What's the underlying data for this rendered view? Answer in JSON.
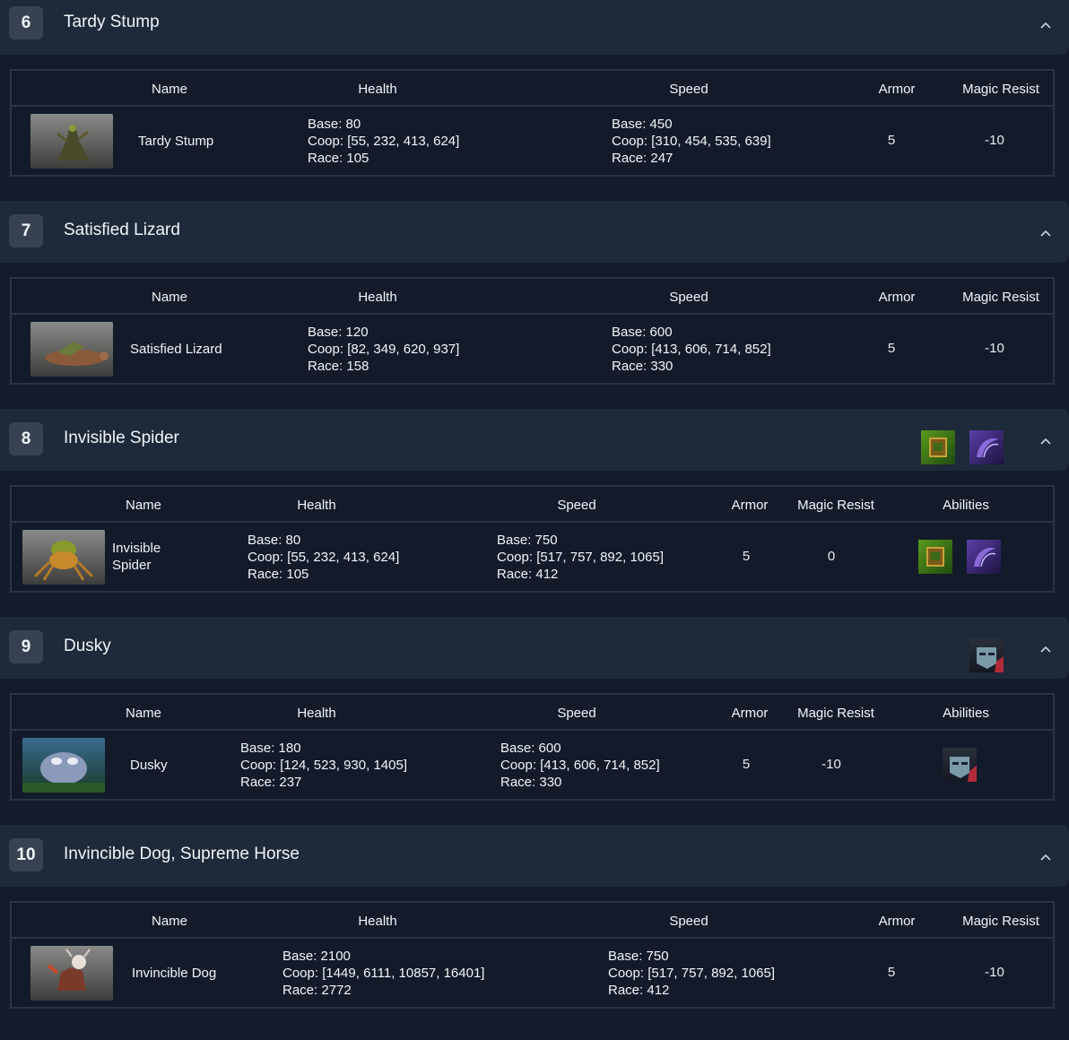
{
  "columns": {
    "name": "Name",
    "health": "Health",
    "speed": "Speed",
    "armor": "Armor",
    "magic_resist": "Magic Resist",
    "abilities": "Abilities"
  },
  "waves": [
    {
      "number": "6",
      "title": "Tardy Stump",
      "header_abilities": [],
      "unit": {
        "name": "Tardy Stump",
        "health_base": "Base: 80",
        "health_coop": "Coop: [55, 232, 413, 624]",
        "health_race": "Race: 105",
        "speed_base": "Base: 450",
        "speed_coop": "Coop: [310, 454, 535, 639]",
        "speed_race": "Race: 247",
        "armor": "5",
        "magic_resist": "-10",
        "abilities": []
      }
    },
    {
      "number": "7",
      "title": "Satisfied Lizard",
      "header_abilities": [],
      "unit": {
        "name": "Satisfied Lizard",
        "health_base": "Base: 120",
        "health_coop": "Coop: [82, 349, 620, 937]",
        "health_race": "Race: 158",
        "speed_base": "Base: 600",
        "speed_coop": "Coop: [413, 606, 714, 852]",
        "speed_race": "Race: 330",
        "armor": "5",
        "magic_resist": "-10",
        "abilities": []
      }
    },
    {
      "number": "8",
      "title": "Invisible Spider",
      "header_abilities": [
        "green-ability-icon",
        "purple-ability-icon"
      ],
      "unit": {
        "name_line1": "Invisible",
        "name_line2": "Spider",
        "health_base": "Base: 80",
        "health_coop": "Coop: [55, 232, 413, 624]",
        "health_race": "Race: 105",
        "speed_base": "Base: 750",
        "speed_coop": "Coop: [517, 757, 892, 1065]",
        "speed_race": "Race: 412",
        "armor": "5",
        "magic_resist": "0",
        "abilities": [
          "green-ability-icon",
          "purple-ability-icon"
        ]
      }
    },
    {
      "number": "9",
      "title": "Dusky",
      "header_abilities": [
        "face-ability-icon"
      ],
      "unit": {
        "name": "Dusky",
        "health_base": "Base: 180",
        "health_coop": "Coop: [124, 523, 930, 1405]",
        "health_race": "Race: 237",
        "speed_base": "Base: 600",
        "speed_coop": "Coop: [413, 606, 714, 852]",
        "speed_race": "Race: 330",
        "armor": "5",
        "magic_resist": "-10",
        "abilities": [
          "face-ability-icon"
        ]
      }
    },
    {
      "number": "10",
      "title": "Invincible Dog, Supreme Horse",
      "header_abilities": [],
      "unit": {
        "name": "Invincible Dog",
        "health_base": "Base: 2100",
        "health_coop": "Coop: [1449, 6111, 10857, 16401]",
        "health_race": "Race: 2772",
        "speed_base": "Base: 750",
        "speed_coop": "Coop: [517, 757, 892, 1065]",
        "speed_race": "Race: 412",
        "armor": "5",
        "magic_resist": "-10",
        "abilities": []
      }
    }
  ]
}
